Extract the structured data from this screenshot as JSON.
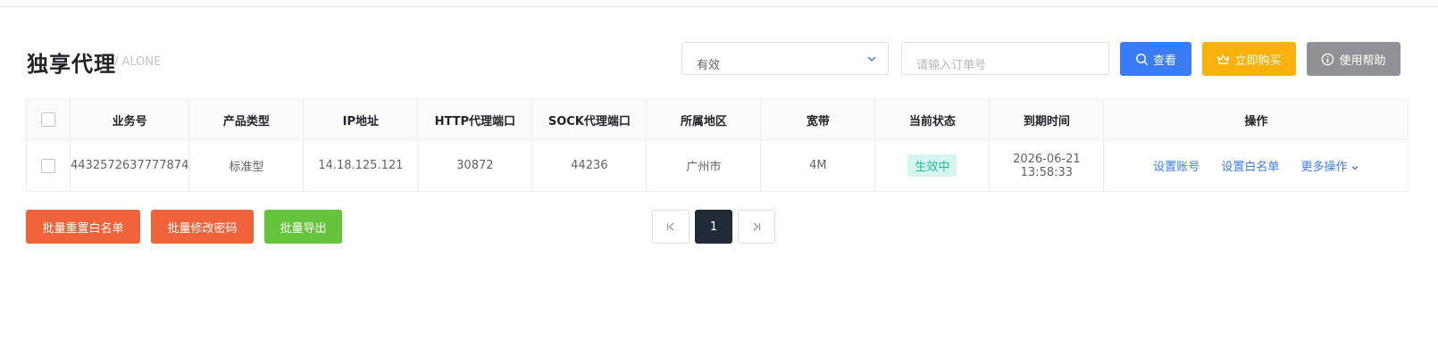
{
  "header": {
    "title": "独享代理",
    "subtitle": "/ ALONE"
  },
  "filters": {
    "status_value": "有效",
    "order_placeholder": "请输入订单号",
    "search_label": "查看",
    "buy_label": "立即购买",
    "help_label": "使用帮助"
  },
  "table": {
    "columns": [
      "业务号",
      "产品类型",
      "IP地址",
      "HTTP代理端口",
      "SOCK代理端口",
      "所属地区",
      "宽带",
      "当前状态",
      "到期时间",
      "操作"
    ],
    "rows": [
      {
        "order_no": "4432572637777874",
        "product_type": "标准型",
        "ip": "14.18.125.121",
        "http_port": "30872",
        "sock_port": "44236",
        "region": "广州市",
        "bandwidth": "4M",
        "status": "生效中",
        "expire": "2026-06-21 13:58:33",
        "actions": {
          "set_account": "设置账号",
          "set_whitelist": "设置白名单",
          "more": "更多操作"
        }
      }
    ]
  },
  "batch": {
    "reset_whitelist": "批量重置白名单",
    "change_password": "批量修改密码",
    "export": "批量导出"
  },
  "pagination": {
    "current": "1"
  },
  "colors": {
    "primary": "#3a7cf7",
    "warning": "#f9b10c",
    "danger": "#f0633a",
    "success": "#66c33c",
    "info": "#8f9297"
  }
}
